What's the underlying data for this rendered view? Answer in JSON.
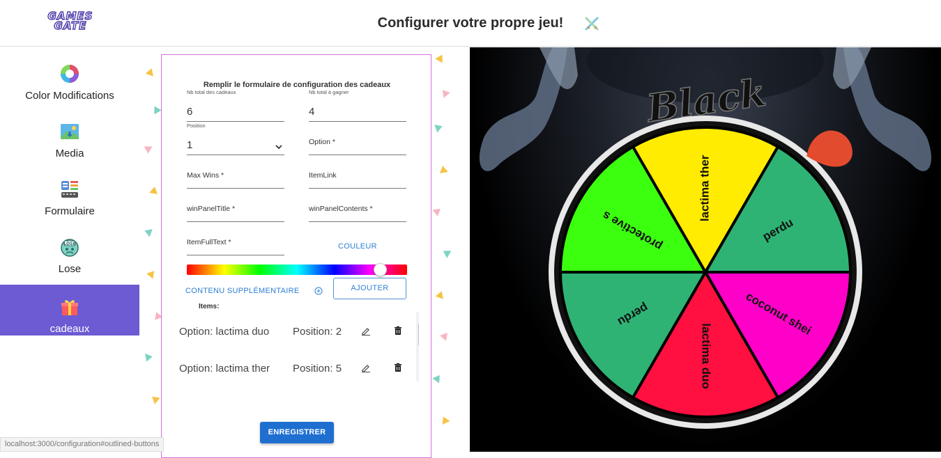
{
  "header": {
    "logo_text": "GAMES GATE",
    "title": "Configurer votre propre jeu!"
  },
  "sidebar": {
    "items": [
      {
        "label": "Color Modifications",
        "icon": "color-wheel-icon"
      },
      {
        "label": "Media",
        "icon": "image-icon"
      },
      {
        "label": "Formulaire",
        "icon": "form-icon"
      },
      {
        "label": "Lose",
        "icon": "lose-face-icon"
      },
      {
        "label": "cadeaux",
        "icon": "gift-icon",
        "active": true
      }
    ],
    "active_color": "#6c5bd3"
  },
  "form": {
    "title": "Remplir le formulaire de configuration des cadeaux",
    "nb_total_label": "Nb total des cadeaux",
    "nb_total_value": "6",
    "nb_win_label": "Nb total à gagner",
    "nb_win_value": "4",
    "position_label": "Position",
    "position_value": "1",
    "option_placeholder": "Option *",
    "max_wins_placeholder": "Max Wins *",
    "item_link_placeholder": "ItemLink",
    "win_panel_title_placeholder": "winPanelTitle *",
    "win_panel_contents_placeholder": "winPanelContents *",
    "item_full_text_placeholder": "ItemFullText *",
    "couleur_label": "COULEUR",
    "hue_value_percent": 87,
    "contenu_label": "CONTENU SUPPLÉMENTAIRE",
    "ajouter_label": "AJOUTER",
    "items_label": "Items:",
    "items": [
      {
        "option": "Option: lactima duo",
        "position": "Position: 2"
      },
      {
        "option": "Option: lactima ther",
        "position": "Position: 5"
      }
    ],
    "save_label": "ENREGISTRER"
  },
  "status_bar": {
    "url": "localhost:3000/configuration#outlined-buttons"
  },
  "wheel": {
    "title_text": "Black",
    "segments": [
      {
        "label": "lactima ther",
        "color": "#ffec00"
      },
      {
        "label": "perdu",
        "color": "#2fb374"
      },
      {
        "label": "coconut shei",
        "color": "#ff00c8"
      },
      {
        "label": "lactima duo",
        "color": "#ff1040"
      },
      {
        "label": "perdu",
        "color": "#2fb374"
      },
      {
        "label": "protective s",
        "color": "#3cff10"
      }
    ],
    "pointer_color": "#e34b2e"
  }
}
